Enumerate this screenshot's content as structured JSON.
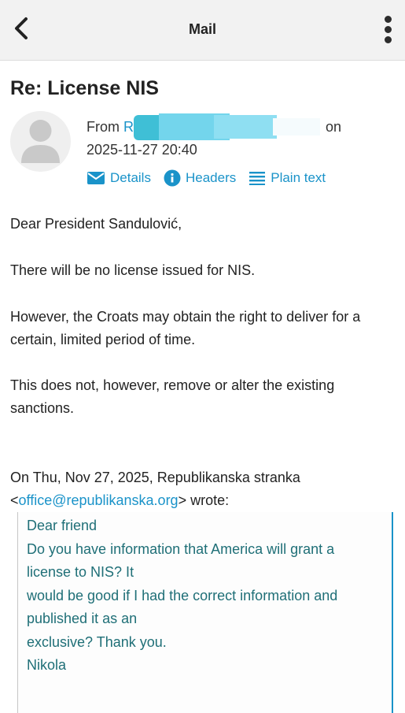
{
  "header": {
    "title": "Mail",
    "back_icon": "chevron-left-icon",
    "menu_icon": "kebab-menu-icon"
  },
  "message": {
    "subject": "Re: License NIS",
    "from_label": "From",
    "from_partial": "R",
    "on_label": "on",
    "date": "2025-11-27 20:40",
    "actions": {
      "details": "Details",
      "headers": "Headers",
      "plain_text": "Plain text"
    },
    "body": {
      "greeting": "Dear President Sandulović,",
      "p1": "There will be no license issued for NIS.",
      "p2": "However, the Croats may obtain the right to deliver for a certain, limited period of time.",
      "p3": "This does not, however, remove or alter the existing sanctions."
    },
    "quote_intro": {
      "line1": "On Thu, Nov 27, 2025, Republikanska stranka",
      "open_bracket": "<",
      "email": "office@republikanska.org",
      "close": "> wrote:"
    },
    "quoted": [
      "Dear friend",
      "Do you have information that America will grant a",
      "license to NIS? It",
      "would be good if I had the correct information and",
      "published it as an",
      "exclusive? Thank you.",
      "Nikola"
    ]
  },
  "colors": {
    "accent": "#1a93c9",
    "quote_text": "#1f6f77",
    "redaction": "#7fd8ee",
    "topbar": "#f2f2f2"
  }
}
